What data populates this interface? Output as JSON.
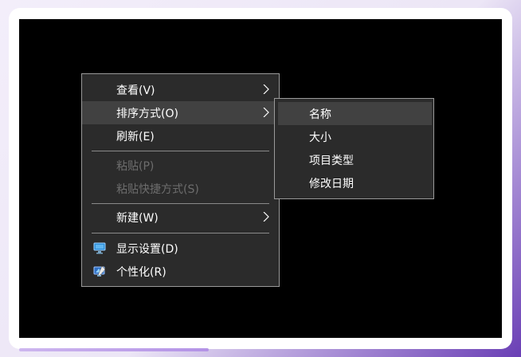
{
  "context_menu": {
    "items": [
      {
        "label": "查看(V)",
        "has_submenu": true
      },
      {
        "label": "排序方式(O)",
        "has_submenu": true,
        "highlighted": true
      },
      {
        "label": "刷新(E)"
      },
      {
        "label": "粘贴(P)",
        "disabled": true
      },
      {
        "label": "粘贴快捷方式(S)",
        "disabled": true
      },
      {
        "label": "新建(W)",
        "has_submenu": true
      },
      {
        "label": "显示设置(D)",
        "icon": "display-settings-icon"
      },
      {
        "label": "个性化(R)",
        "icon": "personalize-icon"
      }
    ]
  },
  "sort_submenu": {
    "items": [
      {
        "label": "名称",
        "highlighted": true
      },
      {
        "label": "大小"
      },
      {
        "label": "项目类型"
      },
      {
        "label": "修改日期"
      }
    ]
  },
  "colors": {
    "menu_bg": "#2b2b2b",
    "menu_border": "#9a9a9a",
    "hover_bg": "#414141",
    "disabled_text": "#6d6d6d",
    "desktop_bg": "#000000"
  }
}
